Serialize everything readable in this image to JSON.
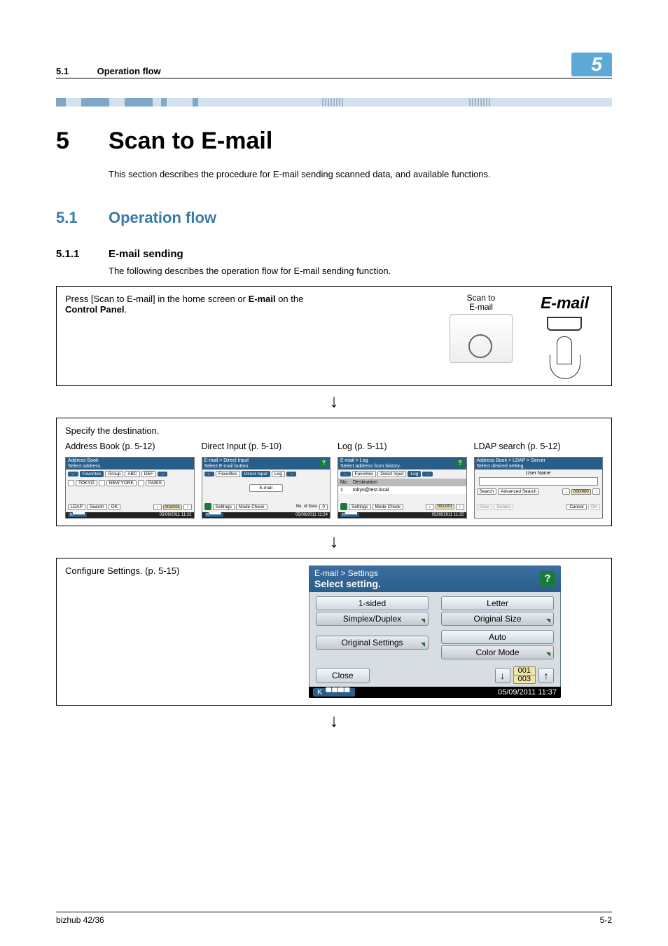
{
  "header": {
    "section_num": "5.1",
    "section_title": "Operation flow",
    "chapter_badge": "5"
  },
  "h1": {
    "num": "5",
    "title": "Scan to E-mail"
  },
  "intro": "This section describes the procedure for E-mail sending scanned data, and available functions.",
  "h2": {
    "num": "5.1",
    "title": "Operation flow"
  },
  "h3": {
    "num": "5.1.1",
    "title": "E-mail sending",
    "desc": "The following describes the operation flow for E-mail sending function."
  },
  "step1": {
    "caption_pre": "Press [Scan to E-mail] in the home screen or ",
    "caption_bold": "E-mail",
    "caption_post": " on the ",
    "caption_bold2": "Control Panel",
    "caption_end": ".",
    "scanto_line1": "Scan to",
    "scanto_line2": "E-mail",
    "email_label": "E-mail"
  },
  "step2": {
    "caption": "Specify the destination.",
    "cols": [
      {
        "label": "Address Book (p. 5-12)"
      },
      {
        "label": "Direct Input (p. 5-10)"
      },
      {
        "label": "Log (p. 5-11)"
      },
      {
        "label": "LDAP search (p. 5-12)"
      }
    ],
    "mini": {
      "addr": {
        "title1": "Address Book",
        "title2": "Select address.",
        "tabs": [
          "Favorites",
          "Group",
          "ABC",
          "DEF"
        ],
        "items": [
          "TOKYO",
          "NEW YORK",
          "PARIS"
        ],
        "btns": [
          "LDAP",
          "Search",
          "OK"
        ],
        "page": "001/001",
        "time": "05/09/2011 11:22"
      },
      "direct": {
        "title1": "E-mail > Direct Input",
        "title2": "Select E-mail button.",
        "tabs": [
          "Favorites",
          "Direct Input",
          "Log"
        ],
        "main_btn": "E-mail",
        "btns": [
          "Settings",
          "Mode Check"
        ],
        "dest_label": "No. of Dest.",
        "dest_val": "0",
        "time": "05/09/2011 11:24"
      },
      "log": {
        "title1": "E-mail > Log",
        "title2": "Select address from history.",
        "tabs": [
          "Favorites",
          "Direct Input",
          "Log"
        ],
        "hdr": [
          "No.",
          "Destination"
        ],
        "row": [
          "1",
          "tokyo@test.local"
        ],
        "btns": [
          "Settings",
          "Mode Check"
        ],
        "page": "001/001",
        "time": "05/09/2011 11:25"
      },
      "ldap": {
        "title1": "Address Book > LDAP > Server",
        "title2": "Select desired setting.",
        "field": "User Name",
        "btns_top": [
          "Search",
          "Advanced Search"
        ],
        "btns_bot": [
          "Save",
          "Details",
          "Cancel",
          "OK"
        ],
        "page": "000/000"
      }
    }
  },
  "step3": {
    "caption": "Configure Settings. (p. 5-15)",
    "panel": {
      "title": "E-mail > Settings",
      "subtitle": "Select setting.",
      "cells": [
        {
          "value": "1-sided",
          "label": "Simplex/Duplex"
        },
        {
          "value": "Letter",
          "label": "Original Size"
        },
        {
          "value": "",
          "label": "Original Settings",
          "novalue": true
        },
        {
          "value": "Auto",
          "label": "Color Mode"
        }
      ],
      "close": "Close",
      "pager": {
        "cur": "001",
        "tot": "003"
      },
      "status": "K",
      "timestamp": "05/09/2011 11:37"
    }
  },
  "footer": {
    "left": "bizhub 42/36",
    "right": "5-2"
  }
}
